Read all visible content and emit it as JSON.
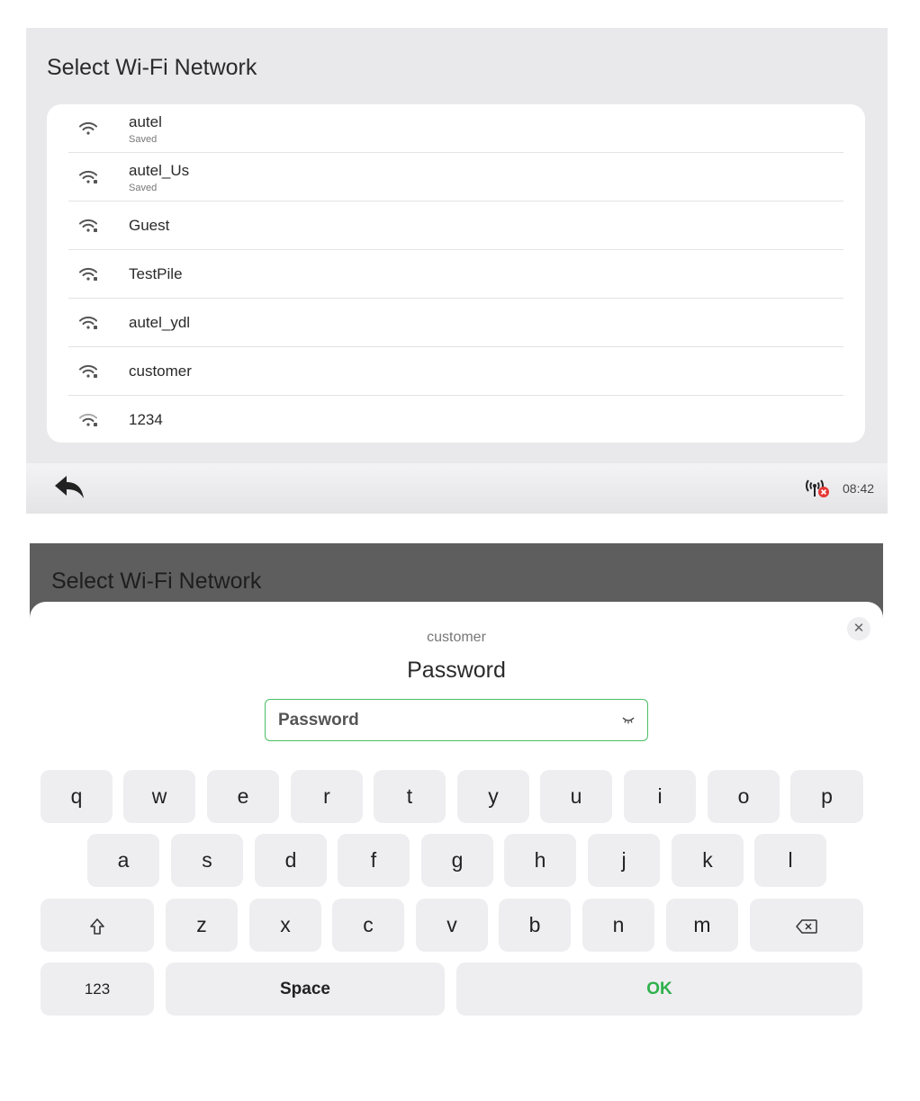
{
  "wifi_screen": {
    "title": "Select Wi-Fi Network",
    "networks": [
      {
        "name": "autel",
        "status": "Saved"
      },
      {
        "name": "autel_Us",
        "status": "Saved"
      },
      {
        "name": "Guest",
        "status": ""
      },
      {
        "name": "TestPile",
        "status": ""
      },
      {
        "name": "autel_ydl",
        "status": ""
      },
      {
        "name": "customer",
        "status": ""
      },
      {
        "name": "1234",
        "status": ""
      }
    ],
    "bottom_bar": {
      "back_icon": "back-arrow-icon",
      "network_status_icon": "network-disconnected-icon",
      "time": "08:42"
    }
  },
  "password_screen": {
    "header_title": "Select Wi-Fi Network",
    "ssid": "customer",
    "dialog_title": "Password",
    "close_label": "✕",
    "input": {
      "value": "",
      "placeholder": "Password"
    },
    "eye_icon": "eye-closed-icon",
    "keyboard": {
      "row1": [
        "q",
        "w",
        "e",
        "r",
        "t",
        "y",
        "u",
        "i",
        "o",
        "p"
      ],
      "row2": [
        "a",
        "s",
        "d",
        "f",
        "g",
        "h",
        "j",
        "k",
        "l"
      ],
      "row3": [
        "z",
        "x",
        "c",
        "v",
        "b",
        "n",
        "m"
      ],
      "shift_icon": "shift-icon",
      "backspace_icon": "backspace-icon",
      "numbers_label": "123",
      "space_label": "Space",
      "ok_label": "OK"
    }
  },
  "colors": {
    "accent_green": "#2fb04b",
    "input_border": "#4cbf66",
    "alert_red": "#e53935",
    "key_bg": "#eeeef1"
  }
}
